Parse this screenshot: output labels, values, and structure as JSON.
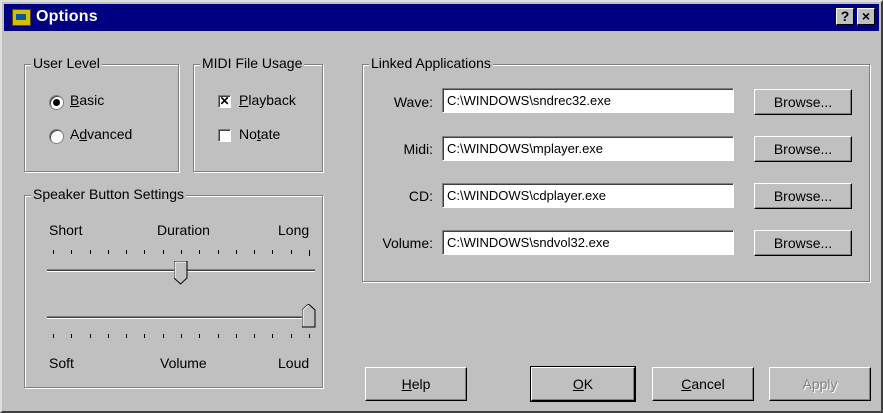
{
  "window": {
    "title": "Options",
    "help_button": "?",
    "close_button": "×"
  },
  "user_level": {
    "legend": "User Level",
    "options": [
      {
        "access": "B",
        "rest": "asic",
        "selected": true
      },
      {
        "pre": "A",
        "access": "d",
        "rest": "vanced",
        "selected": false
      }
    ]
  },
  "midi_file_usage": {
    "legend": "MIDI File Usage",
    "options": [
      {
        "access": "P",
        "rest": "layback",
        "checked": true
      },
      {
        "pre": "No",
        "access": "t",
        "rest": "ate",
        "checked": false
      }
    ]
  },
  "speaker_settings": {
    "legend": "Speaker Button Settings",
    "duration": {
      "label_left": "Short",
      "label_center": "Duration",
      "label_right": "Long",
      "ticks": 15,
      "value_fraction": 0.5
    },
    "volume": {
      "label_left": "Soft",
      "label_center": "Volume",
      "label_right": "Loud",
      "ticks": 15,
      "value_fraction": 1.0
    }
  },
  "linked_apps": {
    "legend": "Linked Applications",
    "rows": [
      {
        "label": "Wave:",
        "path": "C:\\WINDOWS\\sndrec32.exe",
        "button": "Browse..."
      },
      {
        "label": "Midi:",
        "path": "C:\\WINDOWS\\mplayer.exe",
        "button": "Browse..."
      },
      {
        "label": "CD:",
        "path": "C:\\WINDOWS\\cdplayer.exe",
        "button": "Browse..."
      },
      {
        "label": "Volume:",
        "path": "C:\\WINDOWS\\sndvol32.exe",
        "button": "Browse..."
      }
    ]
  },
  "footer": {
    "help": {
      "access": "H",
      "rest": "elp"
    },
    "ok": {
      "access": "O",
      "rest": "K"
    },
    "cancel": {
      "access": "C",
      "rest": "ancel"
    },
    "apply": {
      "label": "Apply",
      "enabled": false
    }
  }
}
